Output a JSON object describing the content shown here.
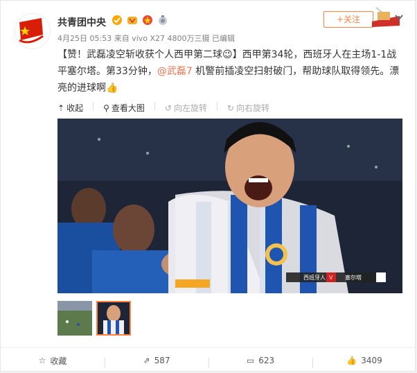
{
  "post": {
    "username": "共青团中央",
    "meta": "4月25日 05:53 来自 vivo X27 4800万三摄  已编辑",
    "text_parts": [
      "【赞！武磊凌空斩收获个人西甲第二球",
      "】西甲第34轮，西班牙人在主场1-1战平塞尔塔。第33分钟，",
      "@武磊7",
      " 机警前插凌空扫射破门，帮助球队取得领先。漂亮的进球啊"
    ],
    "follow_label": "+关注"
  },
  "toolbar": {
    "collect": "收起",
    "view_large": "查看大图",
    "rotate_left": "向左旋转",
    "rotate_right": "向右旋转"
  },
  "scoreboard": {
    "team_home": "西班牙人",
    "vs": "V",
    "team_away": "塞尔塔"
  },
  "footer": {
    "favorite": "收藏",
    "repost": "587",
    "comment": "623",
    "like": "3409"
  },
  "colors": {
    "accent": "#ff8140",
    "mention": "#eb7350"
  },
  "icons": [
    "verified-icon",
    "vip-icon",
    "medal-icon",
    "collapse-icon",
    "zoom-icon",
    "rotate-left-icon",
    "rotate-right-icon",
    "star-icon",
    "repost-icon",
    "comment-icon",
    "like-icon",
    "chevron-down-icon"
  ]
}
